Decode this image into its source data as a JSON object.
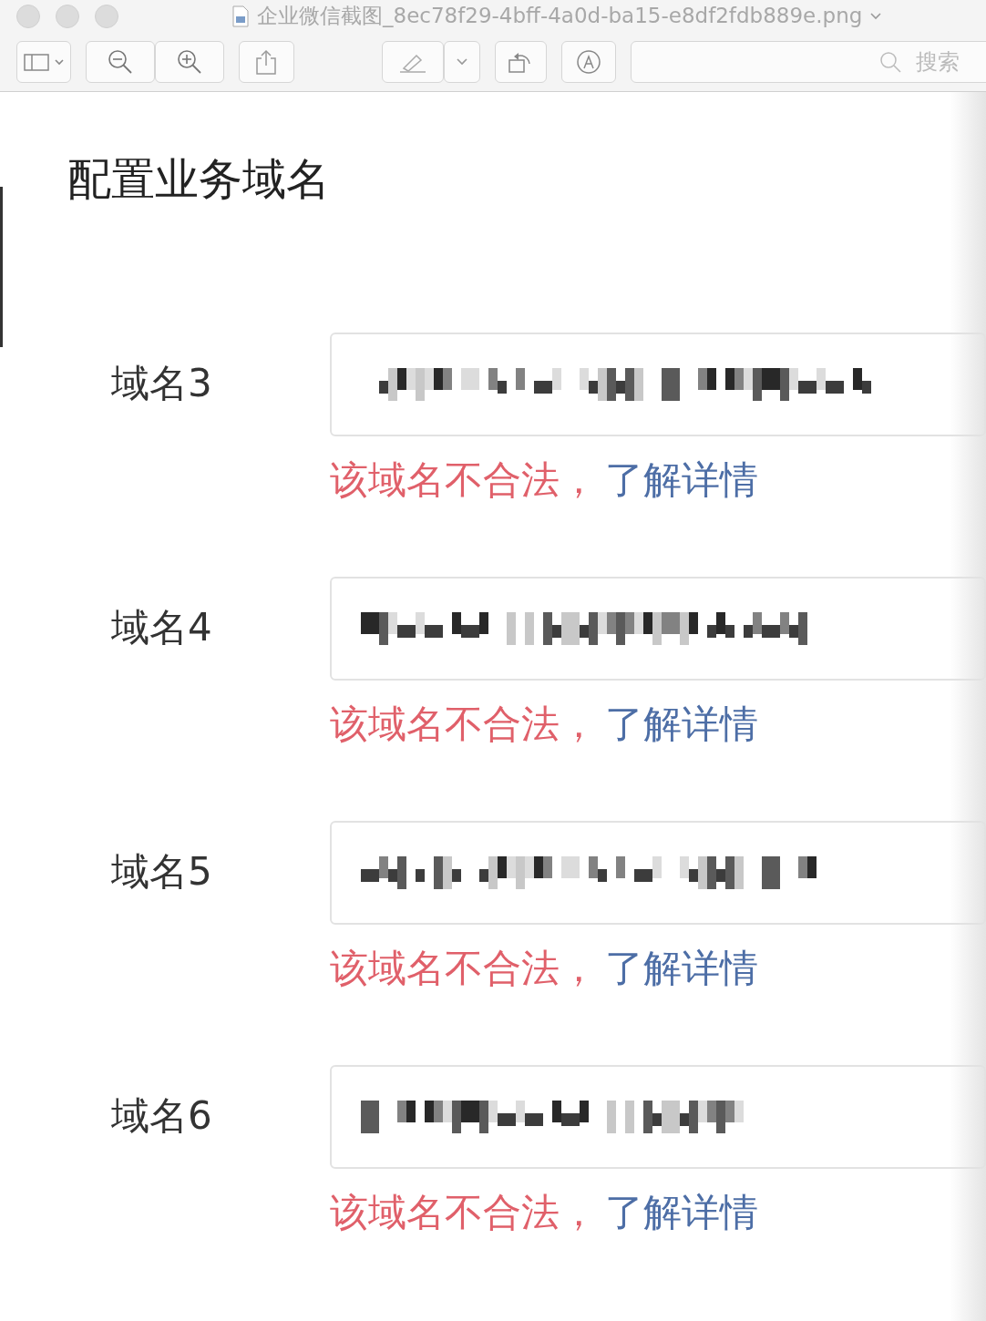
{
  "window": {
    "title": "企业微信截图_8ec78f29-4bff-4a0d-ba15-e8df2fdb889e.png"
  },
  "toolbar": {
    "search": {
      "placeholder": "搜索"
    }
  },
  "page": {
    "title": "配置业务域名",
    "domains": [
      {
        "label": "域名3",
        "error": "该域名不合法，",
        "link": "了解详情"
      },
      {
        "label": "域名4",
        "error": "该域名不合法，",
        "link": "了解详情"
      },
      {
        "label": "域名5",
        "error": "该域名不合法，",
        "link": "了解详情"
      },
      {
        "label": "域名6",
        "error": "该域名不合法，",
        "link": "了解详情"
      }
    ]
  }
}
